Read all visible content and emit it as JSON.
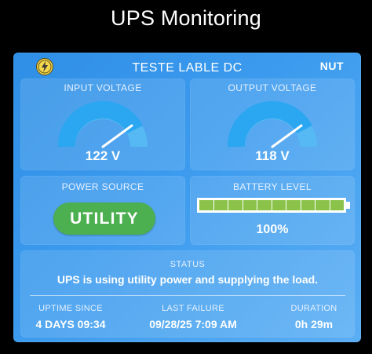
{
  "page": {
    "title": "UPS Monitoring"
  },
  "device": {
    "name": "TESTE LABLE DC",
    "driver": "NUT",
    "logo_icon": "lightning-bolt-icon"
  },
  "input_voltage": {
    "label": "INPUT VOLTAGE",
    "value": "122 V",
    "gauge_fraction": 0.9
  },
  "output_voltage": {
    "label": "OUTPUT VOLTAGE",
    "value": "118 V",
    "gauge_fraction": 0.9
  },
  "power_source": {
    "label": "POWER SOURCE",
    "value": "UTILITY",
    "color": "#4caf50"
  },
  "battery": {
    "label": "BATTERY LEVEL",
    "value": "100%",
    "segments": 10,
    "filled": 10,
    "color": "#8bc34a"
  },
  "status": {
    "label": "STATUS",
    "text": "UPS is using utility power and supplying the load."
  },
  "stats": {
    "uptime": {
      "label": "UPTIME SINCE",
      "value": "4 DAYS 09:34"
    },
    "last_failure": {
      "label": "LAST FAILURE",
      "value": "09/28/25 7:09 AM"
    },
    "duration": {
      "label": "DURATION",
      "value": "0h 29m"
    }
  },
  "colors": {
    "gauge_fill": "#29a3f0",
    "gauge_track": "#4fb5f2",
    "card": "#3c9bee"
  }
}
